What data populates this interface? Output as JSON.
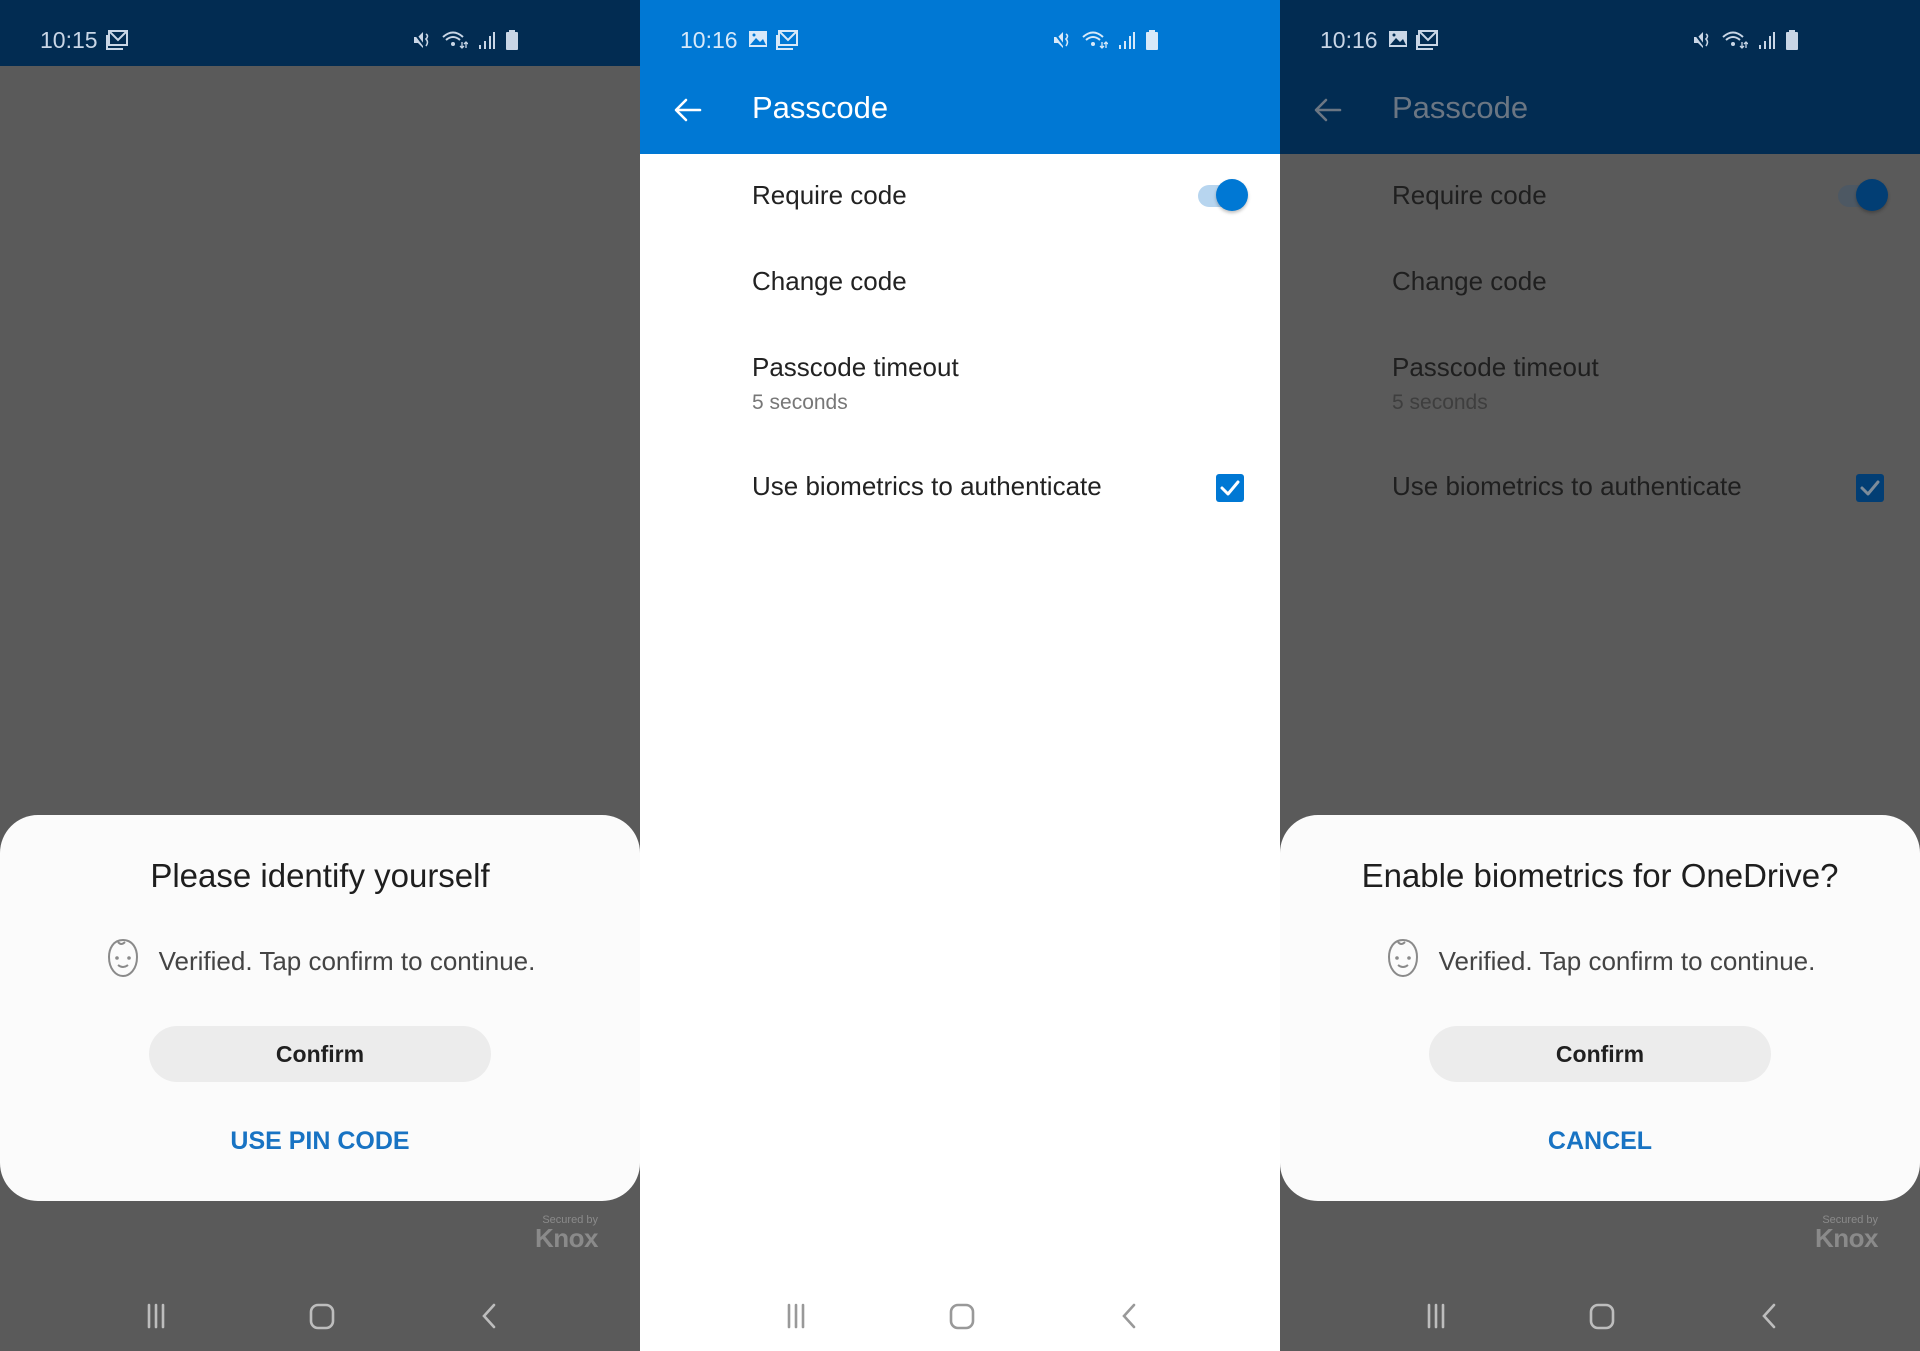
{
  "screens": [
    {
      "status_bar": {
        "time": "10:15",
        "notification_icons": [
          "mail-icon"
        ],
        "system_icons": [
          "mute-icon",
          "wifi-icon",
          "signal-icon",
          "battery-icon"
        ]
      },
      "dialog": {
        "title": "Please identify yourself",
        "message": "Verified. Tap confirm to continue.",
        "message_icon": "face-recognition-icon",
        "confirm_label": "Confirm",
        "secondary_label": "USE PIN CODE"
      },
      "knox": {
        "secured_by": "Secured by",
        "brand": "Knox"
      },
      "nav": [
        "recents-icon",
        "home-icon",
        "back-icon"
      ]
    },
    {
      "status_bar": {
        "time": "10:16",
        "notification_icons": [
          "gallery-icon",
          "mail-icon"
        ],
        "system_icons": [
          "mute-icon",
          "wifi-icon",
          "signal-icon",
          "battery-icon"
        ]
      },
      "app_bar": {
        "title": "Passcode",
        "back_icon": "arrow-back-icon"
      },
      "settings": [
        {
          "label": "Require code",
          "control": "toggle",
          "value": true
        },
        {
          "label": "Change code",
          "control": "none"
        },
        {
          "label": "Passcode timeout",
          "sublabel": "5 seconds",
          "control": "none"
        },
        {
          "label": "Use biometrics to authenticate",
          "control": "checkbox",
          "value": true
        }
      ],
      "nav": [
        "recents-icon",
        "home-icon",
        "back-icon"
      ]
    },
    {
      "status_bar": {
        "time": "10:16",
        "notification_icons": [
          "gallery-icon",
          "mail-icon"
        ],
        "system_icons": [
          "mute-icon",
          "wifi-icon",
          "signal-icon",
          "battery-icon"
        ]
      },
      "app_bar": {
        "title": "Passcode",
        "back_icon": "arrow-back-icon"
      },
      "settings": [
        {
          "label": "Require code",
          "control": "toggle",
          "value": true
        },
        {
          "label": "Change code",
          "control": "none"
        },
        {
          "label": "Passcode timeout",
          "sublabel": "5 seconds",
          "control": "none"
        },
        {
          "label": "Use biometrics to authenticate",
          "control": "checkbox",
          "value": true
        }
      ],
      "dialog": {
        "title": "Enable biometrics for OneDrive?",
        "message": "Verified. Tap confirm to continue.",
        "message_icon": "face-recognition-icon",
        "confirm_label": "Confirm",
        "secondary_label": "CANCEL"
      },
      "knox": {
        "secured_by": "Secured by",
        "brand": "Knox"
      },
      "nav": [
        "recents-icon",
        "home-icon",
        "back-icon"
      ]
    }
  ],
  "colors": {
    "accent_blue": "#0078d4",
    "status_bar_dark": "#022c52",
    "scrim": "#5a5a5a",
    "link_blue": "#1873c3",
    "sheet_bg": "#fbfbfb"
  }
}
